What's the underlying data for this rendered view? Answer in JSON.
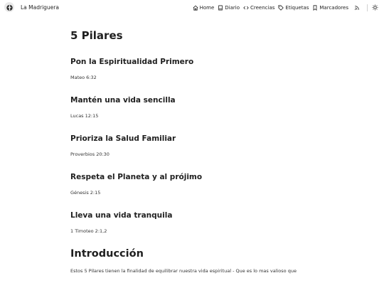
{
  "header": {
    "site_name": "La Madriguera",
    "nav": [
      {
        "label": "Home",
        "icon": "home-icon"
      },
      {
        "label": "Diario",
        "icon": "book-icon"
      },
      {
        "label": "Creencias",
        "icon": "code-icon"
      },
      {
        "label": "Etiquetas",
        "icon": "tag-icon"
      },
      {
        "label": "Marcadores",
        "icon": "bookmark-icon"
      }
    ],
    "rss_icon": "rss-icon",
    "theme_icon": "sun-icon"
  },
  "main": {
    "title": "5 Pilares",
    "pillars": [
      {
        "heading": "Pon la Espiritualidad Primero",
        "ref": "Mateo 6:32"
      },
      {
        "heading": "Mantén una vida sencilla",
        "ref": "Lucas 12:15"
      },
      {
        "heading": "Prioriza la Salud Familiar",
        "ref": "Proverbios 20:30"
      },
      {
        "heading": "Respeta el Planeta y al prójimo",
        "ref": "Génesis 2:15"
      },
      {
        "heading": "Lleva una vida tranquila",
        "ref": "1 Timoteo 2:1,2"
      }
    ],
    "intro_title": "Introducción",
    "intro_text": "Estos 5 Pilares tienen la finalidad de equilibrar nuestra vida espiritual - Que es lo mas valioso que"
  }
}
